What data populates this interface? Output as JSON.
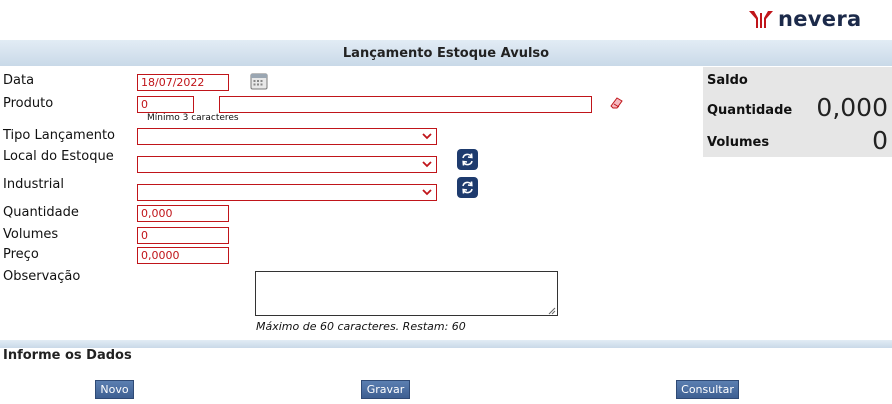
{
  "brand": {
    "name": "nevera",
    "color": "#c0151a"
  },
  "header": {
    "title": "Lançamento Estoque Avulso"
  },
  "form": {
    "data": {
      "label": "Data",
      "value": "18/07/2022"
    },
    "produto": {
      "label": "Produto",
      "code": "0",
      "description": "",
      "hint": "Mínimo 3 caracteres"
    },
    "tipo_lancamento": {
      "label": "Tipo Lançamento",
      "value": ""
    },
    "local_estoque": {
      "label": "Local do Estoque",
      "value": ""
    },
    "industrial": {
      "label": "Industrial",
      "value": ""
    },
    "quantidade": {
      "label": "Quantidade",
      "value": "0,000"
    },
    "volumes": {
      "label": "Volumes",
      "value": "0"
    },
    "preco": {
      "label": "Preço",
      "value": "0,0000"
    },
    "observacao": {
      "label": "Observação",
      "value": "",
      "hint": "Máximo de 60 caracteres. Restam: 60"
    }
  },
  "saldo": {
    "title": "Saldo",
    "quantidade_label": "Quantidade",
    "quantidade_value": "0,000",
    "volumes_label": "Volumes",
    "volumes_value": "0"
  },
  "footer": {
    "title": "Informe os Dados"
  },
  "buttons": {
    "novo": "Novo",
    "gravar": "Gravar",
    "consultar": "Consultar"
  },
  "icons": [
    "calendar-icon",
    "eraser-icon",
    "refresh-icon",
    "chevron-down-icon"
  ]
}
